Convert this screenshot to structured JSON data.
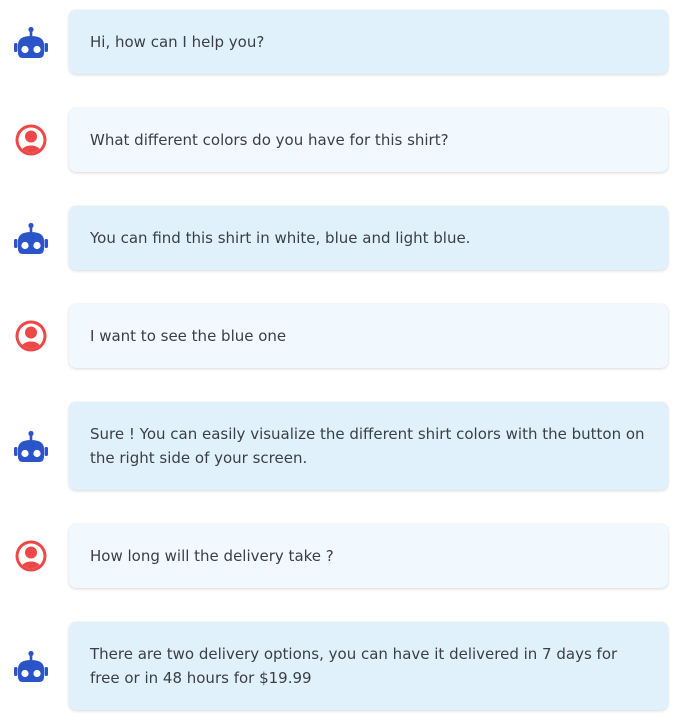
{
  "colors": {
    "bot_icon": "#2b54c8",
    "user_icon": "#ee4747",
    "bot_bubble": "#e1f1fc",
    "user_bubble": "#f1f8fe",
    "text": "#3a3f45"
  },
  "messages": [
    {
      "sender": "bot",
      "icon": "robot-icon",
      "text": "Hi, how can I help you?"
    },
    {
      "sender": "user",
      "icon": "user-icon",
      "text": "What different colors do you have for this shirt?"
    },
    {
      "sender": "bot",
      "icon": "robot-icon",
      "text": "You can find this shirt in white, blue and light blue."
    },
    {
      "sender": "user",
      "icon": "user-icon",
      "text": "I want to see the blue one"
    },
    {
      "sender": "bot",
      "icon": "robot-icon",
      "text": "Sure ! You can easily visualize the different shirt colors with the button on the right side of your screen."
    },
    {
      "sender": "user",
      "icon": "user-icon",
      "text": "How long will the delivery take ?"
    },
    {
      "sender": "bot",
      "icon": "robot-icon",
      "text": "There are two delivery options, you can have it delivered in 7 days for free or in 48 hours for $19.99"
    }
  ]
}
